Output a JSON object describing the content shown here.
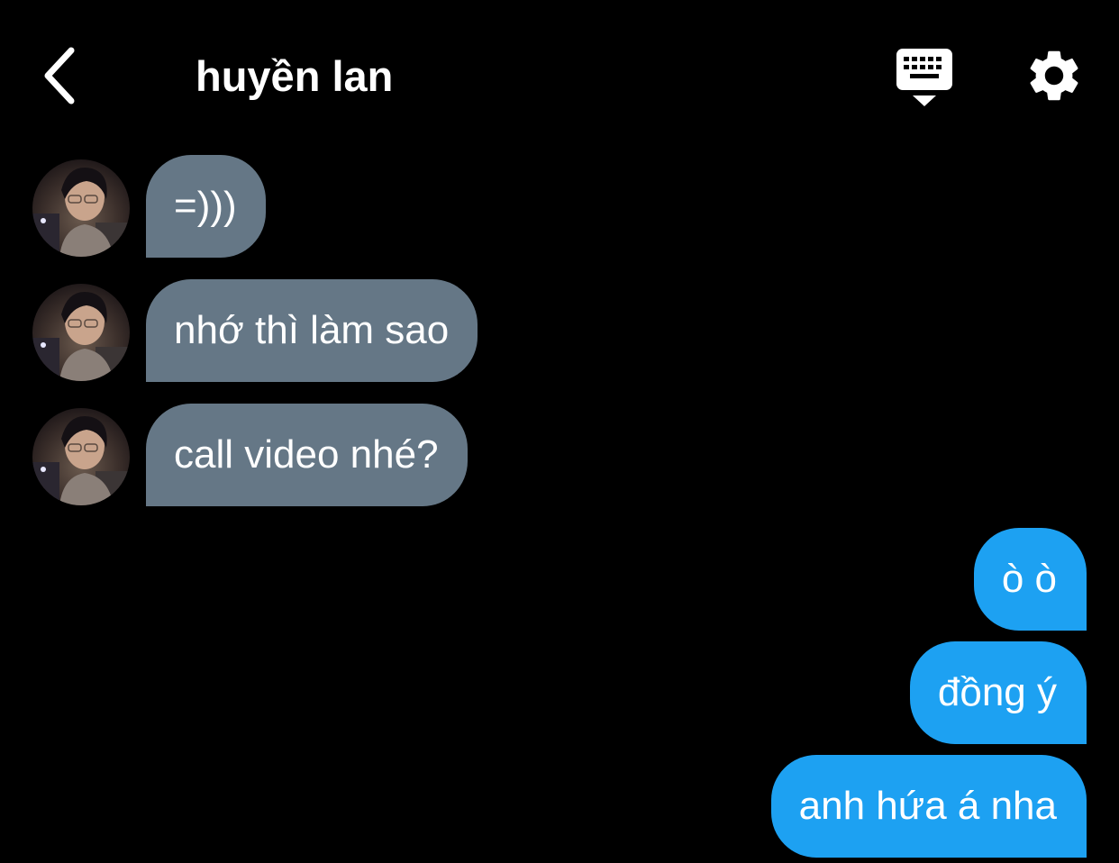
{
  "header": {
    "title": "huyền lan"
  },
  "messages": {
    "received": [
      {
        "text": "=)))"
      },
      {
        "text": "nhớ thì làm sao"
      },
      {
        "text": "call video nhé?"
      }
    ],
    "sent": [
      {
        "text": "ò ò"
      },
      {
        "text": "đồng ý"
      },
      {
        "text": "anh hứa á nha"
      }
    ]
  },
  "colors": {
    "background": "#000000",
    "received_bubble": "#657786",
    "sent_bubble": "#1da1f2",
    "text": "#ffffff"
  },
  "icons": {
    "back": "chevron-left-icon",
    "keyboard": "keyboard-icon",
    "settings": "gear-icon"
  }
}
